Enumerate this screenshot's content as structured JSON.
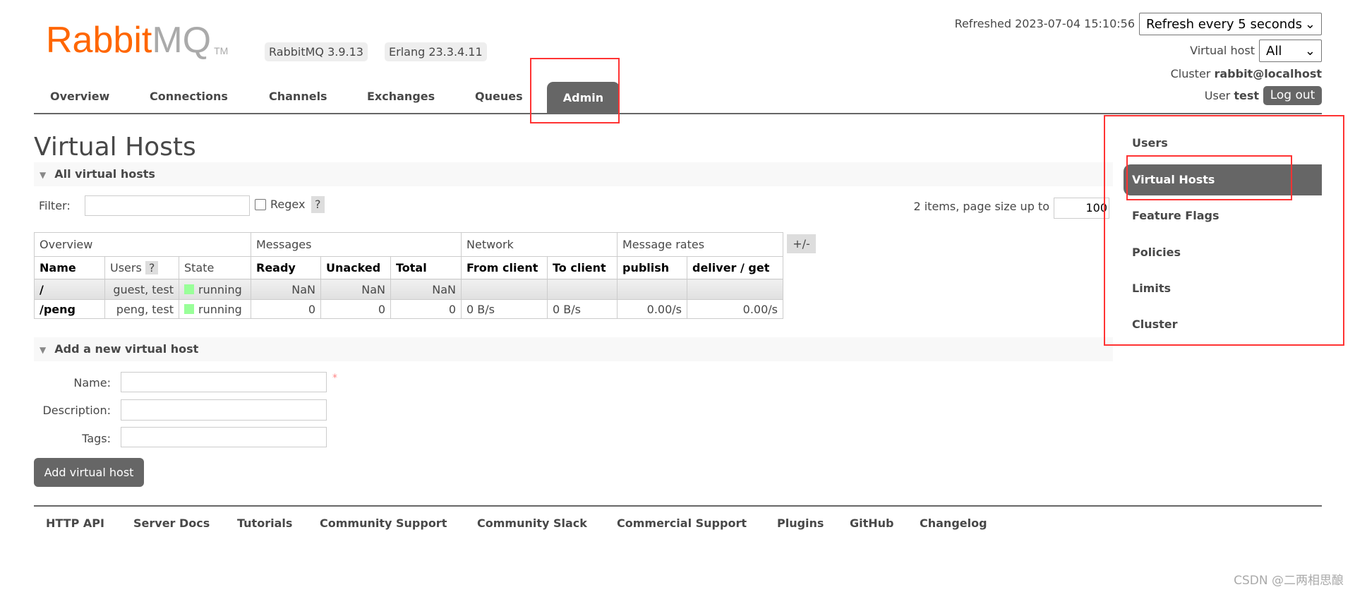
{
  "logo": {
    "rabbit": "Rabbit",
    "mq": "MQ",
    "tm": "TM"
  },
  "badges": {
    "rabbitmq": "RabbitMQ 3.9.13",
    "erlang": "Erlang 23.3.4.11"
  },
  "nav": {
    "tabs": [
      "Overview",
      "Connections",
      "Channels",
      "Exchanges",
      "Queues",
      "Admin"
    ],
    "active": "Admin"
  },
  "status": {
    "refreshed": "Refreshed 2023-07-04 15:10:56",
    "refresh_select": "Refresh every 5 seconds",
    "vhost_label": "Virtual host",
    "vhost_select": "All",
    "cluster_label": "Cluster",
    "cluster": "rabbit@localhost",
    "user_label": "User",
    "user": "test",
    "logout": "Log out"
  },
  "page": {
    "title": "Virtual Hosts",
    "section": "All virtual hosts",
    "filter_label": "Filter:",
    "filter_value": "",
    "regex_label": "Regex",
    "help": "?",
    "items_text": "2 items, page size up to",
    "page_size": "100",
    "plusminus": "+/-"
  },
  "table": {
    "groups": [
      "Overview",
      "Messages",
      "Network",
      "Message rates"
    ],
    "headers": [
      "Name",
      "Users",
      "State",
      "Ready",
      "Unacked",
      "Total",
      "From client",
      "To client",
      "publish",
      "deliver / get"
    ],
    "rows": [
      {
        "name": "/",
        "users": "guest, test",
        "state": "running",
        "ready": "NaN",
        "unacked": "NaN",
        "total": "NaN",
        "from": "",
        "to": "",
        "publish": "",
        "deliver": ""
      },
      {
        "name": "/peng",
        "users": "peng, test",
        "state": "running",
        "ready": "0",
        "unacked": "0",
        "total": "0",
        "from": "0 B/s",
        "to": "0 B/s",
        "publish": "0.00/s",
        "deliver": "0.00/s"
      }
    ]
  },
  "add": {
    "section": "Add a new virtual host",
    "name_label": "Name:",
    "desc_label": "Description:",
    "tags_label": "Tags:",
    "required": "*",
    "button": "Add virtual host"
  },
  "footer": [
    "HTTP API",
    "Server Docs",
    "Tutorials",
    "Community Support",
    "Community Slack",
    "Commercial Support",
    "Plugins",
    "GitHub",
    "Changelog"
  ],
  "admin_menu": [
    "Users",
    "Virtual Hosts",
    "Feature Flags",
    "Policies",
    "Limits",
    "Cluster"
  ],
  "watermark": "CSDN @二两相思酿",
  "colors": {
    "brand": "#ff6600",
    "active_tab": "#666666",
    "running": "#99ff99",
    "annotation": "#ff3333"
  }
}
